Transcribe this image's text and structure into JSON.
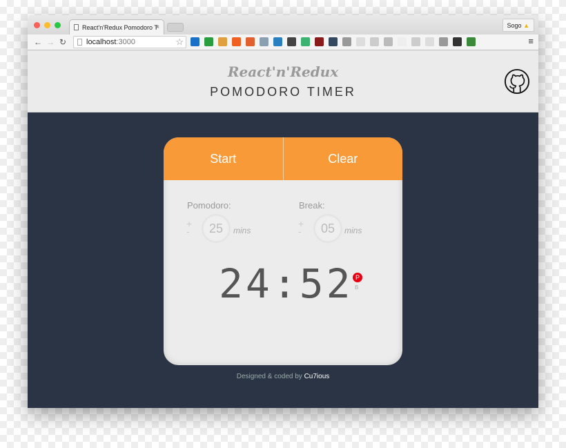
{
  "browser": {
    "tab_title": "React'n'Redux Pomodoro T",
    "url_host": "localhost",
    "url_port": ":3000",
    "profile": "Sogo",
    "extension_colors": [
      "#1a6fc6",
      "#2a9d3e",
      "#e0a040",
      "#f06020",
      "#e06030",
      "#8aa0b0",
      "#2a7fc1",
      "#444",
      "#3cb371",
      "#8b1a1a",
      "#34495e",
      "#999",
      "#ddd",
      "#ccc",
      "#bbb",
      "#eee",
      "#ccc",
      "#ddd",
      "#999",
      "#333",
      "#3a8a3a"
    ]
  },
  "header": {
    "subtitle": "React'n'Redux",
    "title": "POMODORO TIMER"
  },
  "card": {
    "start_label": "Start",
    "clear_label": "Clear",
    "pomodoro": {
      "label": "Pomodoro:",
      "value": "25",
      "unit": "mins"
    },
    "break": {
      "label": "Break:",
      "value": "05",
      "unit": "mins"
    },
    "time": "24:52",
    "mode_p": "P",
    "mode_b": "B"
  },
  "footer": {
    "text": "Designed & coded by ",
    "author": "Cu7ious"
  },
  "colors": {
    "accent": "#f89a37",
    "background": "#2b3444",
    "active_mode": "#e60012"
  }
}
